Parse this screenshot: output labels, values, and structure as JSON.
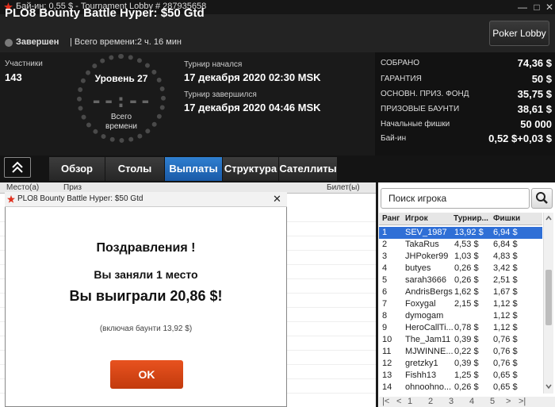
{
  "titlebar": {
    "title": "Бай-ин: 0,55 $ - Tournament Lobby # 287935658"
  },
  "header": {
    "tournament_name": "PLO8 Bounty Battle Hyper: $50 Gtd",
    "status": "Завершен",
    "total_time": "| Всего времени:2 ч. 16 мин",
    "lobby_button": "Poker Lobby"
  },
  "info": {
    "participants_label": "Участники",
    "participants": "143",
    "level": "Уровень 27",
    "clock_digits": "--:--",
    "clock_label_1": "Всего",
    "clock_label_2": "времени",
    "started_label": "Турнир начался",
    "started": "17 декабря 2020  02:30 MSK",
    "ended_label": "Турнир завершился",
    "ended": "17 декабря 2020  04:46 MSK"
  },
  "stats": [
    {
      "label": "СОБРАНО",
      "value": "74,36 $"
    },
    {
      "label": "ГАРАНТИЯ",
      "value": "50 $"
    },
    {
      "label": "ОСНОВН. ПРИЗ. ФОНД",
      "value": "35,75 $"
    },
    {
      "label": "ПРИЗОВЫЕ БАУНТИ",
      "value": "38,61 $"
    },
    {
      "label": "Начальные фишки",
      "value": "50 000"
    },
    {
      "label": "Бай-ин",
      "value": "0,52 $+0,03 $"
    }
  ],
  "tabs": [
    {
      "label": "Обзор",
      "active": false
    },
    {
      "label": "Столы",
      "active": false
    },
    {
      "label": "Выплаты",
      "active": true
    },
    {
      "label": "Структура",
      "active": false
    },
    {
      "label": "Сателлиты",
      "active": false
    }
  ],
  "payout_table": {
    "col_place": "Место(а)",
    "col_prize": "Приз",
    "col_ticket": "Билет(ы)"
  },
  "players": {
    "search_placeholder": "Поиск игрока",
    "col_rank": "Ранг",
    "col_player": "Игрок",
    "col_bounty": "Турнир...",
    "col_chips": "Фишки",
    "rows": [
      {
        "rank": "1",
        "player": "SEV_1987",
        "bounty": "13,92 $",
        "chips": "6,94 $"
      },
      {
        "rank": "2",
        "player": "TakaRus",
        "bounty": "4,53 $",
        "chips": "6,84 $"
      },
      {
        "rank": "3",
        "player": "JHPoker99",
        "bounty": "1,03 $",
        "chips": "4,83 $"
      },
      {
        "rank": "4",
        "player": "butyes",
        "bounty": "0,26 $",
        "chips": "3,42 $"
      },
      {
        "rank": "5",
        "player": "sarah3666",
        "bounty": "0,26 $",
        "chips": "2,51 $"
      },
      {
        "rank": "6",
        "player": "AndrisBergs",
        "bounty": "1,62 $",
        "chips": "1,67 $"
      },
      {
        "rank": "7",
        "player": "Foxygal",
        "bounty": "2,15 $",
        "chips": "1,12 $"
      },
      {
        "rank": "8",
        "player": "dymogam",
        "bounty": "",
        "chips": "1,12 $"
      },
      {
        "rank": "9",
        "player": "HeroCallTi...",
        "bounty": "0,78 $",
        "chips": "1,12 $"
      },
      {
        "rank": "10",
        "player": "The_Jam11",
        "bounty": "0,39 $",
        "chips": "0,76 $"
      },
      {
        "rank": "11",
        "player": "MJWINNE...",
        "bounty": "0,22 $",
        "chips": "0,76 $"
      },
      {
        "rank": "12",
        "player": "gretzky1",
        "bounty": "0,39 $",
        "chips": "0,76 $"
      },
      {
        "rank": "13",
        "player": "Fishh13",
        "bounty": "1,25 $",
        "chips": "0,65 $"
      },
      {
        "rank": "14",
        "player": "ohnoohno...",
        "bounty": "0,26 $",
        "chips": "0,65 $"
      }
    ],
    "pages": [
      "1",
      "2",
      "3",
      "4",
      "5"
    ]
  },
  "modal": {
    "title": "PLO8 Bounty Battle Hyper: $50 Gtd",
    "congrats": "Поздравления !",
    "place": "Вы заняли 1 место",
    "won": "Вы выиграли 20,86 $!",
    "note": "(включая баунти 13,92 $)",
    "ok": "OK"
  },
  "colors": {
    "accent": "#2f6fd6",
    "ok_button": "#d9461a",
    "logo": "#e0301e"
  }
}
